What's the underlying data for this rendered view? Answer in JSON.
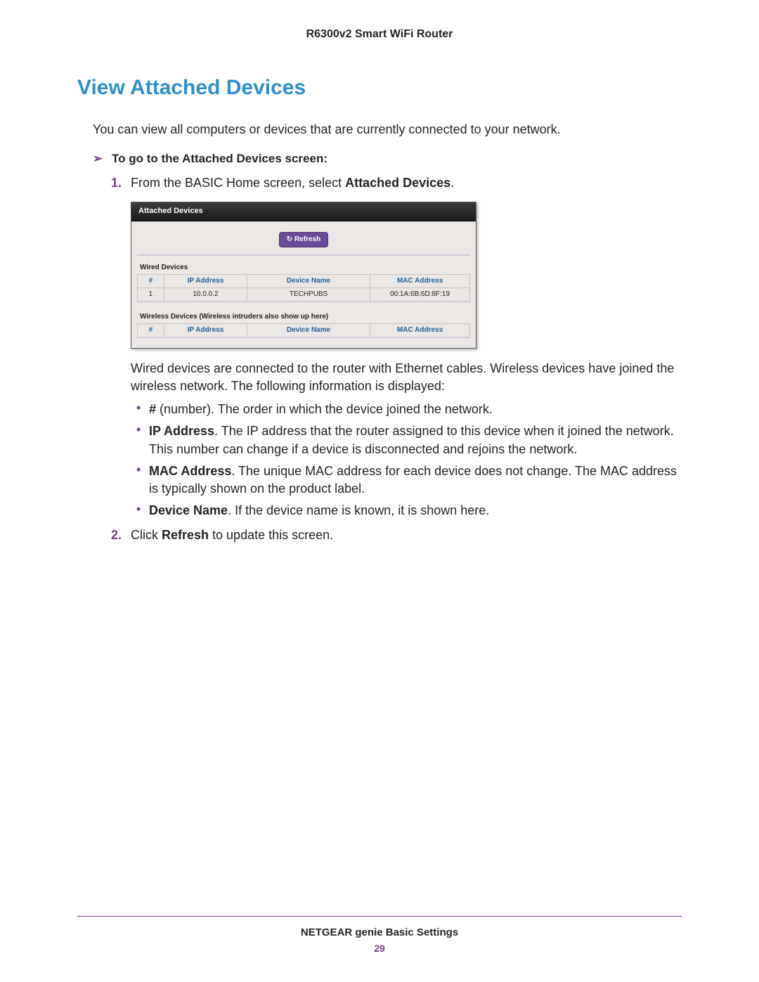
{
  "header": {
    "product_title": "R6300v2 Smart WiFi Router"
  },
  "section": {
    "title": "View Attached Devices",
    "intro": "You can view all computers or devices that are currently connected to your network.",
    "task_heading": "To go to the Attached Devices screen:"
  },
  "steps": {
    "s1": {
      "prefix": "From the BASIC Home screen, select ",
      "bold1": "Attached Devices",
      "suffix": "."
    },
    "after_ss_para": "Wired devices are connected to the router with Ethernet cables. Wireless devices have joined the wireless network. The following information is displayed:",
    "bullets": {
      "b1": {
        "bold": "#",
        "rest": " (number). The order in which the device joined the network."
      },
      "b2": {
        "bold": "IP Address",
        "rest": ". The IP address that the router assigned to this device when it joined the network. This number can change if a device is disconnected and rejoins the network."
      },
      "b3": {
        "bold": "MAC Address",
        "rest": ". The unique MAC address for each device does not change. The MAC address is typically shown on the product label."
      },
      "b4": {
        "bold": "Device Name",
        "rest": ". If the device name is known, it is shown here."
      }
    },
    "s2": {
      "prefix": "Click ",
      "bold1": "Refresh",
      "suffix": " to update this screen."
    }
  },
  "screenshot": {
    "title": "Attached Devices",
    "refresh_label": "Refresh",
    "wired_label": "Wired Devices",
    "wireless_label": "Wireless Devices (Wireless intruders also show up here)",
    "columns": {
      "num": "#",
      "ip": "IP Address",
      "name": "Device Name",
      "mac": "MAC Address"
    },
    "wired_rows": {
      "r1": {
        "num": "1",
        "ip": "10.0.0.2",
        "name": "TECHPUBS",
        "mac": "00:1A:6B:6D:8F:19"
      }
    }
  },
  "footer": {
    "text": "NETGEAR genie Basic Settings",
    "page": "29"
  }
}
